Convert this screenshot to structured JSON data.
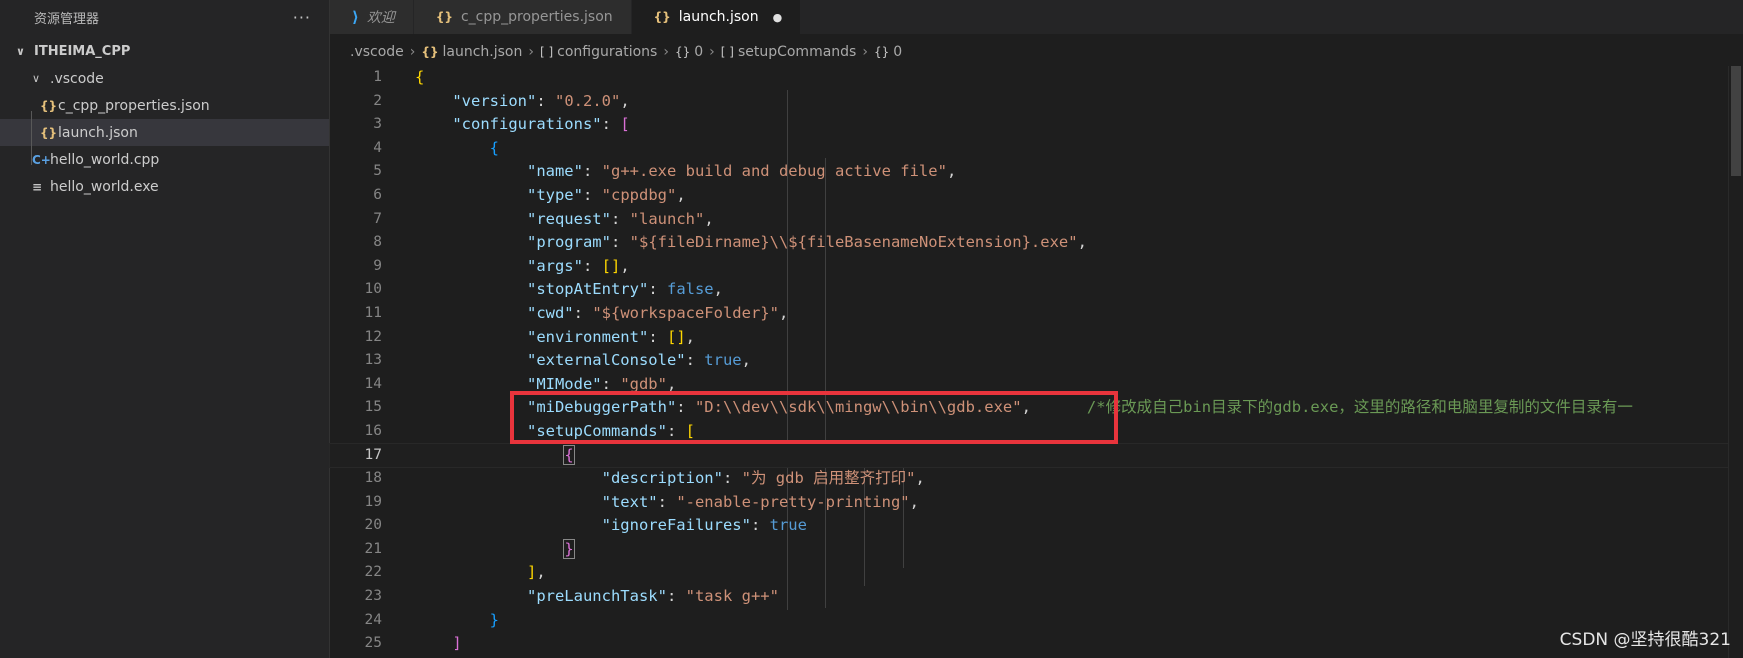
{
  "sidebar": {
    "title": "资源管理器",
    "more": "···",
    "root": "ITHEIMA_CPP",
    "items": [
      {
        "label": ".vscode",
        "icon": "chevron-down-icon"
      },
      {
        "label": "c_cpp_properties.json",
        "icon": "json-braces-icon",
        "glyph": "{}"
      },
      {
        "label": "launch.json",
        "icon": "json-braces-icon",
        "glyph": "{}"
      },
      {
        "label": "hello_world.cpp",
        "icon": "cpp-file-icon",
        "glyph": "C+"
      },
      {
        "label": "hello_world.exe",
        "icon": "exe-file-icon",
        "glyph": "≡"
      }
    ]
  },
  "tabs": [
    {
      "label": "欢迎",
      "icon": "vscode-logo-icon"
    },
    {
      "label": "c_cpp_properties.json",
      "icon": "json-braces-icon",
      "glyph": "{}"
    },
    {
      "label": "launch.json",
      "icon": "json-braces-icon",
      "glyph": "{}",
      "dirty": "●"
    }
  ],
  "breadcrumb": [
    ".vscode",
    "launch.json",
    "configurations",
    "0",
    "setupCommands",
    "0"
  ],
  "editor": {
    "current_line": 17,
    "lines": [
      {
        "n": "1"
      },
      {
        "n": "2"
      },
      {
        "n": "3"
      },
      {
        "n": "4"
      },
      {
        "n": "5"
      },
      {
        "n": "6"
      },
      {
        "n": "7"
      },
      {
        "n": "8"
      },
      {
        "n": "9"
      },
      {
        "n": "10"
      },
      {
        "n": "11"
      },
      {
        "n": "12"
      },
      {
        "n": "13"
      },
      {
        "n": "14"
      },
      {
        "n": "15"
      },
      {
        "n": "16"
      },
      {
        "n": "17"
      },
      {
        "n": "18"
      },
      {
        "n": "19"
      },
      {
        "n": "20"
      },
      {
        "n": "21"
      },
      {
        "n": "22"
      },
      {
        "n": "23"
      },
      {
        "n": "24"
      },
      {
        "n": "25"
      }
    ],
    "tokens": {
      "version_key": "\"version\"",
      "version_val": "\"0.2.0\"",
      "configurations_key": "\"configurations\"",
      "name_key": "\"name\"",
      "name_val": "\"g++.exe build and debug active file\"",
      "type_key": "\"type\"",
      "type_val": "\"cppdbg\"",
      "request_key": "\"request\"",
      "request_val": "\"launch\"",
      "program_key": "\"program\"",
      "program_val": "\"${fileDirname}\\\\${fileBasenameNoExtension}.exe\"",
      "args_key": "\"args\"",
      "stop_key": "\"stopAtEntry\"",
      "stop_val": "false",
      "cwd_key": "\"cwd\"",
      "cwd_val": "\"${workspaceFolder}\"",
      "env_key": "\"environment\"",
      "ext_key": "\"externalConsole\"",
      "ext_val": "true",
      "mimode_key": "\"MIMode\"",
      "mimode_val": "\"gdb\"",
      "midbg_key": "\"miDebuggerPath\"",
      "midbg_val": "\"D:\\\\dev\\\\sdk\\\\mingw\\\\bin\\\\gdb.exe\"",
      "midbg_comment": "/*修改成自己bin目录下的gdb.exe，这里的路径和电脑里复制的文件目录有一",
      "setup_key": "\"setupCommands\"",
      "desc_key": "\"description\"",
      "desc_val": "\"为 gdb 启用整齐打印\"",
      "text_key": "\"text\"",
      "text_val": "\"-enable-pretty-printing\"",
      "ignore_key": "\"ignoreFailures\"",
      "ignore_val": "true",
      "prelaunch_key": "\"preLaunchTask\"",
      "prelaunch_val": "\"task g++\""
    }
  },
  "watermark": "CSDN @坚持很酷321",
  "colors": {
    "highlight_box": "#e8343c",
    "json_key": "#9cdcfe",
    "json_string": "#ce9178",
    "json_bool": "#569cd6",
    "comment": "#6a9955"
  }
}
